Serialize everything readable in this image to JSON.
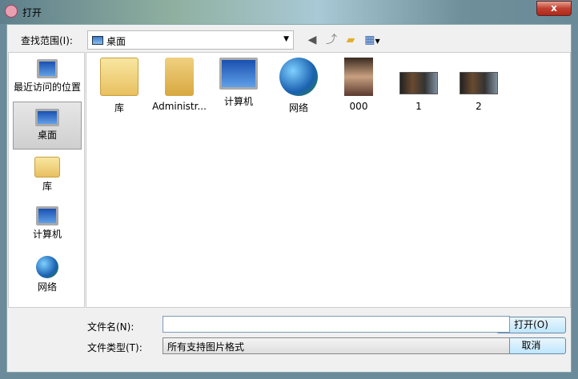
{
  "window": {
    "title": "打开",
    "close_label": "x"
  },
  "lookin": {
    "label": "查找范围(I):",
    "value": "桌面"
  },
  "toolbar": {
    "icons": [
      "back-icon",
      "up-folder-icon",
      "new-folder-icon",
      "view-menu-icon"
    ]
  },
  "sidebar": {
    "items": [
      {
        "label": "最近访问的位置",
        "icon": "recent-places-icon"
      },
      {
        "label": "桌面",
        "icon": "desktop-icon",
        "selected": true
      },
      {
        "label": "库",
        "icon": "libraries-icon"
      },
      {
        "label": "计算机",
        "icon": "computer-icon"
      },
      {
        "label": "网络",
        "icon": "network-icon"
      }
    ]
  },
  "files": [
    {
      "name": "库",
      "icon": "libraries-icon"
    },
    {
      "name": "Administr...",
      "icon": "user-folder-icon"
    },
    {
      "name": "计算机",
      "icon": "computer-icon"
    },
    {
      "name": "网络",
      "icon": "network-icon"
    },
    {
      "name": "000",
      "icon": "image-thumbnail"
    },
    {
      "name": "1",
      "icon": "image-thumbnail"
    },
    {
      "name": "2",
      "icon": "image-thumbnail"
    }
  ],
  "filename": {
    "label": "文件名(N):",
    "value": ""
  },
  "filetype": {
    "label": "文件类型(T):",
    "value": "所有支持图片格式"
  },
  "buttons": {
    "open": "打开(O)",
    "cancel": "取消"
  }
}
